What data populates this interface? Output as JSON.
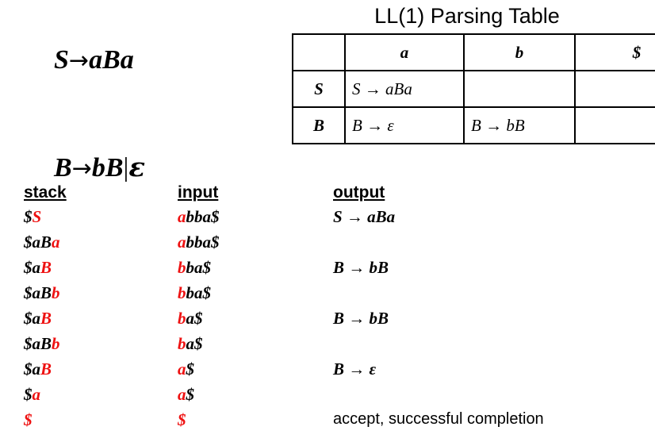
{
  "grammar": {
    "rules": [
      {
        "lhs": "S",
        "arrow": "→",
        "rhs": "aBa"
      },
      {
        "lhs": "B",
        "arrow": "→",
        "rhs": "bB",
        "alt_separator": "|",
        "alt": "ε"
      }
    ]
  },
  "parse_table": {
    "title": "LL(1) Parsing Table",
    "corner_label": "",
    "column_headers": [
      "a",
      "b",
      "$"
    ],
    "rows": [
      {
        "nonterminal": "S",
        "cells": [
          "S → aBa",
          "",
          ""
        ]
      },
      {
        "nonterminal": "B",
        "cells": [
          "B → ε",
          "B → bB",
          ""
        ]
      }
    ]
  },
  "trace": {
    "headers": {
      "stack": "stack",
      "input": "input",
      "output": "output"
    },
    "rows": [
      {
        "stack": [
          {
            "t": "$",
            "c": "black"
          },
          {
            "t": "S",
            "c": "red"
          }
        ],
        "input": [
          {
            "t": "a",
            "c": "red"
          },
          {
            "t": "bba$",
            "c": "black"
          }
        ],
        "output": "S → aBa",
        "output_style": "production"
      },
      {
        "stack": [
          {
            "t": "$aB",
            "c": "black"
          },
          {
            "t": "a",
            "c": "red"
          }
        ],
        "input": [
          {
            "t": "a",
            "c": "red"
          },
          {
            "t": "bba$",
            "c": "black"
          }
        ],
        "output": "",
        "output_style": "production"
      },
      {
        "stack": [
          {
            "t": "$a",
            "c": "black"
          },
          {
            "t": "B",
            "c": "red"
          }
        ],
        "input": [
          {
            "t": "b",
            "c": "red"
          },
          {
            "t": "ba$",
            "c": "black"
          }
        ],
        "output": "B → bB",
        "output_style": "production"
      },
      {
        "stack": [
          {
            "t": "$aB",
            "c": "black"
          },
          {
            "t": "b",
            "c": "red"
          }
        ],
        "input": [
          {
            "t": "b",
            "c": "red"
          },
          {
            "t": "ba$",
            "c": "black"
          }
        ],
        "output": "",
        "output_style": "production"
      },
      {
        "stack": [
          {
            "t": "$a",
            "c": "black"
          },
          {
            "t": "B",
            "c": "red"
          }
        ],
        "input": [
          {
            "t": "b",
            "c": "red"
          },
          {
            "t": "a$",
            "c": "black"
          }
        ],
        "output": "B → bB",
        "output_style": "production"
      },
      {
        "stack": [
          {
            "t": "$aB",
            "c": "black"
          },
          {
            "t": "b",
            "c": "red"
          }
        ],
        "input": [
          {
            "t": "b",
            "c": "red"
          },
          {
            "t": "a$",
            "c": "black"
          }
        ],
        "output": "",
        "output_style": "production"
      },
      {
        "stack": [
          {
            "t": "$a",
            "c": "black"
          },
          {
            "t": "B",
            "c": "red"
          }
        ],
        "input": [
          {
            "t": "a",
            "c": "red"
          },
          {
            "t": "$",
            "c": "black"
          }
        ],
        "output": "B → ε",
        "output_style": "production"
      },
      {
        "stack": [
          {
            "t": "$",
            "c": "black"
          },
          {
            "t": "a",
            "c": "red"
          }
        ],
        "input": [
          {
            "t": "a",
            "c": "red"
          },
          {
            "t": "$",
            "c": "black"
          }
        ],
        "output": "",
        "output_style": "production"
      },
      {
        "stack": [
          {
            "t": "$",
            "c": "red"
          }
        ],
        "input": [
          {
            "t": "$",
            "c": "red"
          }
        ],
        "output": "accept, successful completion",
        "output_style": "plain"
      }
    ]
  },
  "colors": {
    "highlight": "#ee1111",
    "text": "#000000",
    "background": "#ffffff",
    "border": "#000000"
  }
}
